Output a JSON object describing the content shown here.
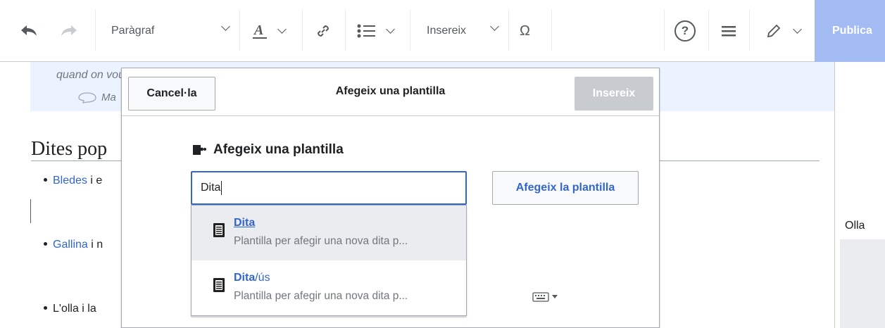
{
  "toolbar": {
    "paragraph_label": "Paràgraf",
    "insert_label": "Insereix",
    "publish_label": "Publica",
    "special_char": "Ω",
    "help_symbol": "?"
  },
  "page": {
    "quote_text": "quand on voudrait atteindre les étoiles",
    "quote_source": "Ma",
    "heading": "Dites pop",
    "items": [
      {
        "link": "Bledes",
        "rest": " i e"
      },
      {
        "link": "Gallina",
        "rest": " i n"
      },
      {
        "link": "",
        "rest": "L'olla i la "
      }
    ],
    "side_text": "Olla"
  },
  "dialog": {
    "cancel_label": "Cancel·la",
    "title": "Afegeix una plantilla",
    "insert_label": "Insereix",
    "section_title": "Afegeix una plantilla",
    "search_value": "Dita",
    "add_label": "Afegeix la plantilla",
    "suggestions": [
      {
        "title_bold": "Dita",
        "title_rest": "",
        "description": "Plantilla per afegir una nova dita p..."
      },
      {
        "title_bold": "Dita",
        "title_rest": "/ús",
        "description": "Plantilla per afegir una nova dita p..."
      }
    ]
  },
  "colors": {
    "accent": "#3366cc",
    "publish_bg": "#a3bbf3",
    "quote_bg": "#eaf3ff",
    "disabled_bg": "#c8ccd1"
  }
}
